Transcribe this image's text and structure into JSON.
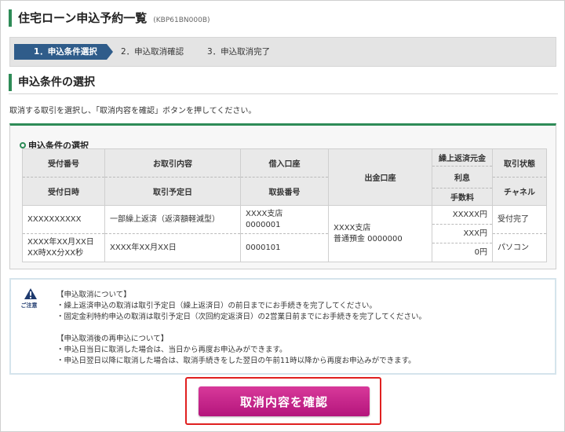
{
  "page": {
    "title": "住宅ローン申込予約一覧",
    "code": "(KBP61BN000B)"
  },
  "steps": [
    {
      "label": "1．申込条件選択",
      "active": true
    },
    {
      "label": "2．申込取消確認",
      "active": false
    },
    {
      "label": "3．申込取消完了",
      "active": false
    }
  ],
  "section": {
    "title": "申込条件の選択",
    "instruction": "取消する取引を選択し、「取消内容を確認」ボタンを押してください。"
  },
  "conditions": {
    "title": "申込条件の選択",
    "headers": {
      "receipt_no": "受付番号",
      "receipt_datetime": "受付日時",
      "transaction": "お取引内容",
      "scheduled_date": "取引予定日",
      "deposit_account": "借入口座",
      "handling_no": "取扱番号",
      "withdrawal_account": "出金口座",
      "principal": "繰上返済元金",
      "interest": "利息",
      "fee": "手数料",
      "status": "取引状態",
      "channel": "チャネル"
    },
    "row": {
      "receipt_no": "XXXXXXXXXX",
      "receipt_datetime_1": "XXXX年XX月XX日",
      "receipt_datetime_2": "XX時XX分XX秒",
      "transaction": "一部繰上返済（返済額軽減型）",
      "scheduled_date": "XXXX年XX月XX日",
      "deposit_branch": "XXXX支店",
      "deposit_account": "0000001",
      "handling_no": "0000101",
      "withdrawal_branch": "XXXX支店",
      "withdrawal_account": "普通預金 0000000",
      "principal": "XXXXX円",
      "interest": "XXX円",
      "fee": "0円",
      "status": "受付完了",
      "channel": "パソコン"
    }
  },
  "notice": {
    "label": "ご注意",
    "lines": [
      "【申込取消について】",
      "・繰上返済申込の取消は取引予定日（繰上返済日）の前日までにお手続きを完了してください。",
      "・固定金利特約申込の取消は取引予定日（次回約定返済日）の2営業日前までにお手続きを完了してください。",
      "",
      "【申込取消後の再申込について】",
      "・申込日当日に取消した場合は、当日から再度お申込みができます。",
      "・申込日翌日以降に取消した場合は、取消手続きをした翌日の午前11時以降から再度お申込みができます。"
    ]
  },
  "confirm_button": "取消内容を確認",
  "colors": {
    "accent_green": "#2e8b57",
    "step_active": "#2f5c8a",
    "button": "#c7258c",
    "highlight": "#e02020"
  }
}
